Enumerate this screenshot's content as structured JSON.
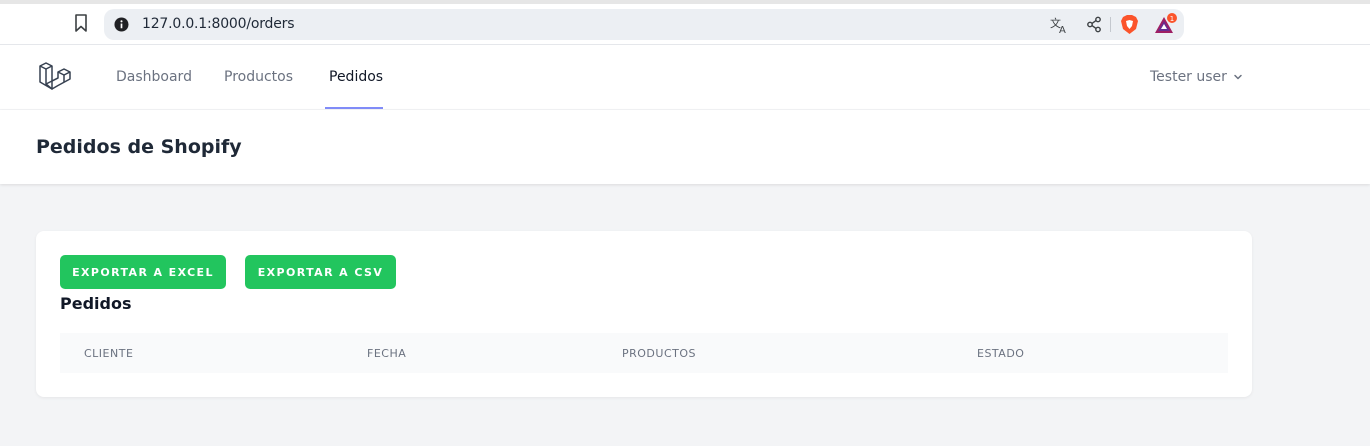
{
  "browser": {
    "url": "127.0.0.1:8000/orders",
    "rewards_badge": "1"
  },
  "nav": {
    "items": [
      {
        "label": "Dashboard"
      },
      {
        "label": "Productos"
      },
      {
        "label": "Pedidos",
        "active": true
      }
    ],
    "user": "Tester user"
  },
  "header": {
    "title": "Pedidos de Shopify"
  },
  "card": {
    "export_excel": "EXPORTAR A EXCEL",
    "export_csv": "EXPORTAR A CSV",
    "section_title": "Pedidos",
    "columns": [
      "CLIENTE",
      "FECHA",
      "PRODUCTOS",
      "ESTADO"
    ]
  },
  "colors": {
    "accent": "#818cf8",
    "button": "#22c55e"
  }
}
